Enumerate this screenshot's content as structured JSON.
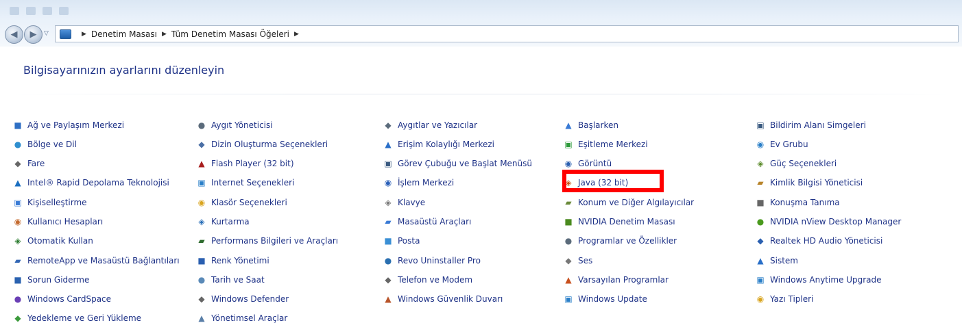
{
  "breadcrumb": {
    "items": [
      "Denetim Masası",
      "Tüm Denetim Masası Öğeleri"
    ]
  },
  "page_title": "Bilgisayarınızın ayarlarını düzenleyin",
  "colors": {
    "link": "#1e3287",
    "highlight_border": "#ff0000"
  },
  "columns": [
    [
      {
        "label": "Ağ ve Paylaşım Merkezi",
        "icon": "network-icon",
        "color": "#2f6fc4"
      },
      {
        "label": "Bölge ve Dil",
        "icon": "globe-icon",
        "color": "#2f8fcf"
      },
      {
        "label": "Fare",
        "icon": "mouse-icon",
        "color": "#666666"
      },
      {
        "label": "Intel® Rapid Depolama Teknolojisi",
        "icon": "intel-icon",
        "color": "#1b6fc0"
      },
      {
        "label": "Kişiselleştirme",
        "icon": "personalization-icon",
        "color": "#3a7bd5"
      },
      {
        "label": "Kullanıcı Hesapları",
        "icon": "users-icon",
        "color": "#c46a2f"
      },
      {
        "label": "Otomatik Kullan",
        "icon": "autoplay-icon",
        "color": "#2e7d32"
      },
      {
        "label": "RemoteApp ve Masaüstü Bağlantıları",
        "icon": "remoteapp-icon",
        "color": "#3367b5"
      },
      {
        "label": "Sorun Giderme",
        "icon": "troubleshooting-icon",
        "color": "#2a62b0"
      },
      {
        "label": "Windows CardSpace",
        "icon": "cardspace-icon",
        "color": "#6a3fb5"
      },
      {
        "label": "Yedekleme ve Geri Yükleme",
        "icon": "backup-icon",
        "color": "#3b9a3b"
      }
    ],
    [
      {
        "label": "Aygıt Yöneticisi",
        "icon": "device-manager-icon",
        "color": "#5b6b7b"
      },
      {
        "label": "Dizin Oluşturma Seçenekleri",
        "icon": "indexing-icon",
        "color": "#4a6fa5"
      },
      {
        "label": "Flash Player (32 bit)",
        "icon": "flash-icon",
        "color": "#a81e1e"
      },
      {
        "label": "Internet Seçenekleri",
        "icon": "internet-options-icon",
        "color": "#2a7fc8"
      },
      {
        "label": "Klasör Seçenekleri",
        "icon": "folder-options-icon",
        "color": "#d9a520"
      },
      {
        "label": "Kurtarma",
        "icon": "recovery-icon",
        "color": "#2a6fb8"
      },
      {
        "label": "Performans Bilgileri ve Araçları",
        "icon": "performance-icon",
        "color": "#2e6b2e"
      },
      {
        "label": "Renk Yönetimi",
        "icon": "color-management-icon",
        "color": "#2a5fb0"
      },
      {
        "label": "Tarih ve Saat",
        "icon": "clock-icon",
        "color": "#5a8ab8"
      },
      {
        "label": "Windows Defender",
        "icon": "defender-icon",
        "color": "#666666"
      },
      {
        "label": "Yönetimsel Araçlar",
        "icon": "admin-tools-icon",
        "color": "#5a7fa8"
      }
    ],
    [
      {
        "label": "Aygıtlar ve Yazıcılar",
        "icon": "printer-icon",
        "color": "#5b6b7b"
      },
      {
        "label": "Erişim Kolaylığı Merkezi",
        "icon": "accessibility-icon",
        "color": "#2a6fc8"
      },
      {
        "label": "Görev Çubuğu ve Başlat Menüsü",
        "icon": "taskbar-icon",
        "color": "#3a5a80"
      },
      {
        "label": "İşlem Merkezi",
        "icon": "flag-icon",
        "color": "#2a5fb8"
      },
      {
        "label": "Klavye",
        "icon": "keyboard-icon",
        "color": "#777777"
      },
      {
        "label": "Masaüstü Araçları",
        "icon": "gadgets-icon",
        "color": "#3a7bd5"
      },
      {
        "label": "Posta",
        "icon": "mail-icon",
        "color": "#3a8fd5"
      },
      {
        "label": "Revo Uninstaller Pro",
        "icon": "revo-icon",
        "color": "#2a6fb0"
      },
      {
        "label": "Telefon ve Modem",
        "icon": "modem-icon",
        "color": "#666666"
      },
      {
        "label": "Windows Güvenlik Duvarı",
        "icon": "firewall-icon",
        "color": "#b8542a"
      }
    ],
    [
      {
        "label": "Başlarken",
        "icon": "getting-started-icon",
        "color": "#3a7bd5"
      },
      {
        "label": "Eşitleme Merkezi",
        "icon": "sync-icon",
        "color": "#2e9a3b"
      },
      {
        "label": "Görüntü",
        "icon": "display-icon",
        "color": "#2a5fb0"
      },
      {
        "label": "Java (32 bit)",
        "icon": "java-icon",
        "color": "#c85a1e"
      },
      {
        "label": "Konum ve Diğer Algılayıcılar",
        "icon": "sensor-icon",
        "color": "#6a8a3a"
      },
      {
        "label": "NVIDIA Denetim Masası",
        "icon": "nvidia-icon",
        "color": "#4a8a1e"
      },
      {
        "label": "Programlar ve Özellikler",
        "icon": "programs-icon",
        "color": "#5b6b7b"
      },
      {
        "label": "Ses",
        "icon": "speaker-icon",
        "color": "#777777"
      },
      {
        "label": "Varsayılan Programlar",
        "icon": "default-programs-icon",
        "color": "#c8501e"
      },
      {
        "label": "Windows Update",
        "icon": "windows-update-icon",
        "color": "#2a7fc8"
      }
    ],
    [
      {
        "label": "Bildirim Alanı Simgeleri",
        "icon": "notification-icon",
        "color": "#3a5a80"
      },
      {
        "label": "Ev Grubu",
        "icon": "homegroup-icon",
        "color": "#2a7fc8"
      },
      {
        "label": "Güç Seçenekleri",
        "icon": "power-icon",
        "color": "#5a8a2a"
      },
      {
        "label": "Kimlik Bilgisi Yöneticisi",
        "icon": "credential-icon",
        "color": "#b8842a"
      },
      {
        "label": "Konuşma Tanıma",
        "icon": "microphone-icon",
        "color": "#666666"
      },
      {
        "label": "NVIDIA nView Desktop Manager",
        "icon": "nview-icon",
        "color": "#4a9a1e"
      },
      {
        "label": "Realtek HD Audio Yöneticisi",
        "icon": "realtek-icon",
        "color": "#2a5fb0"
      },
      {
        "label": "Sistem",
        "icon": "system-icon",
        "color": "#2a6fc8"
      },
      {
        "label": "Windows Anytime Upgrade",
        "icon": "anytime-upgrade-icon",
        "color": "#2a7fc8"
      },
      {
        "label": "Yazı Tipleri",
        "icon": "fonts-icon",
        "color": "#d9a520"
      }
    ]
  ]
}
